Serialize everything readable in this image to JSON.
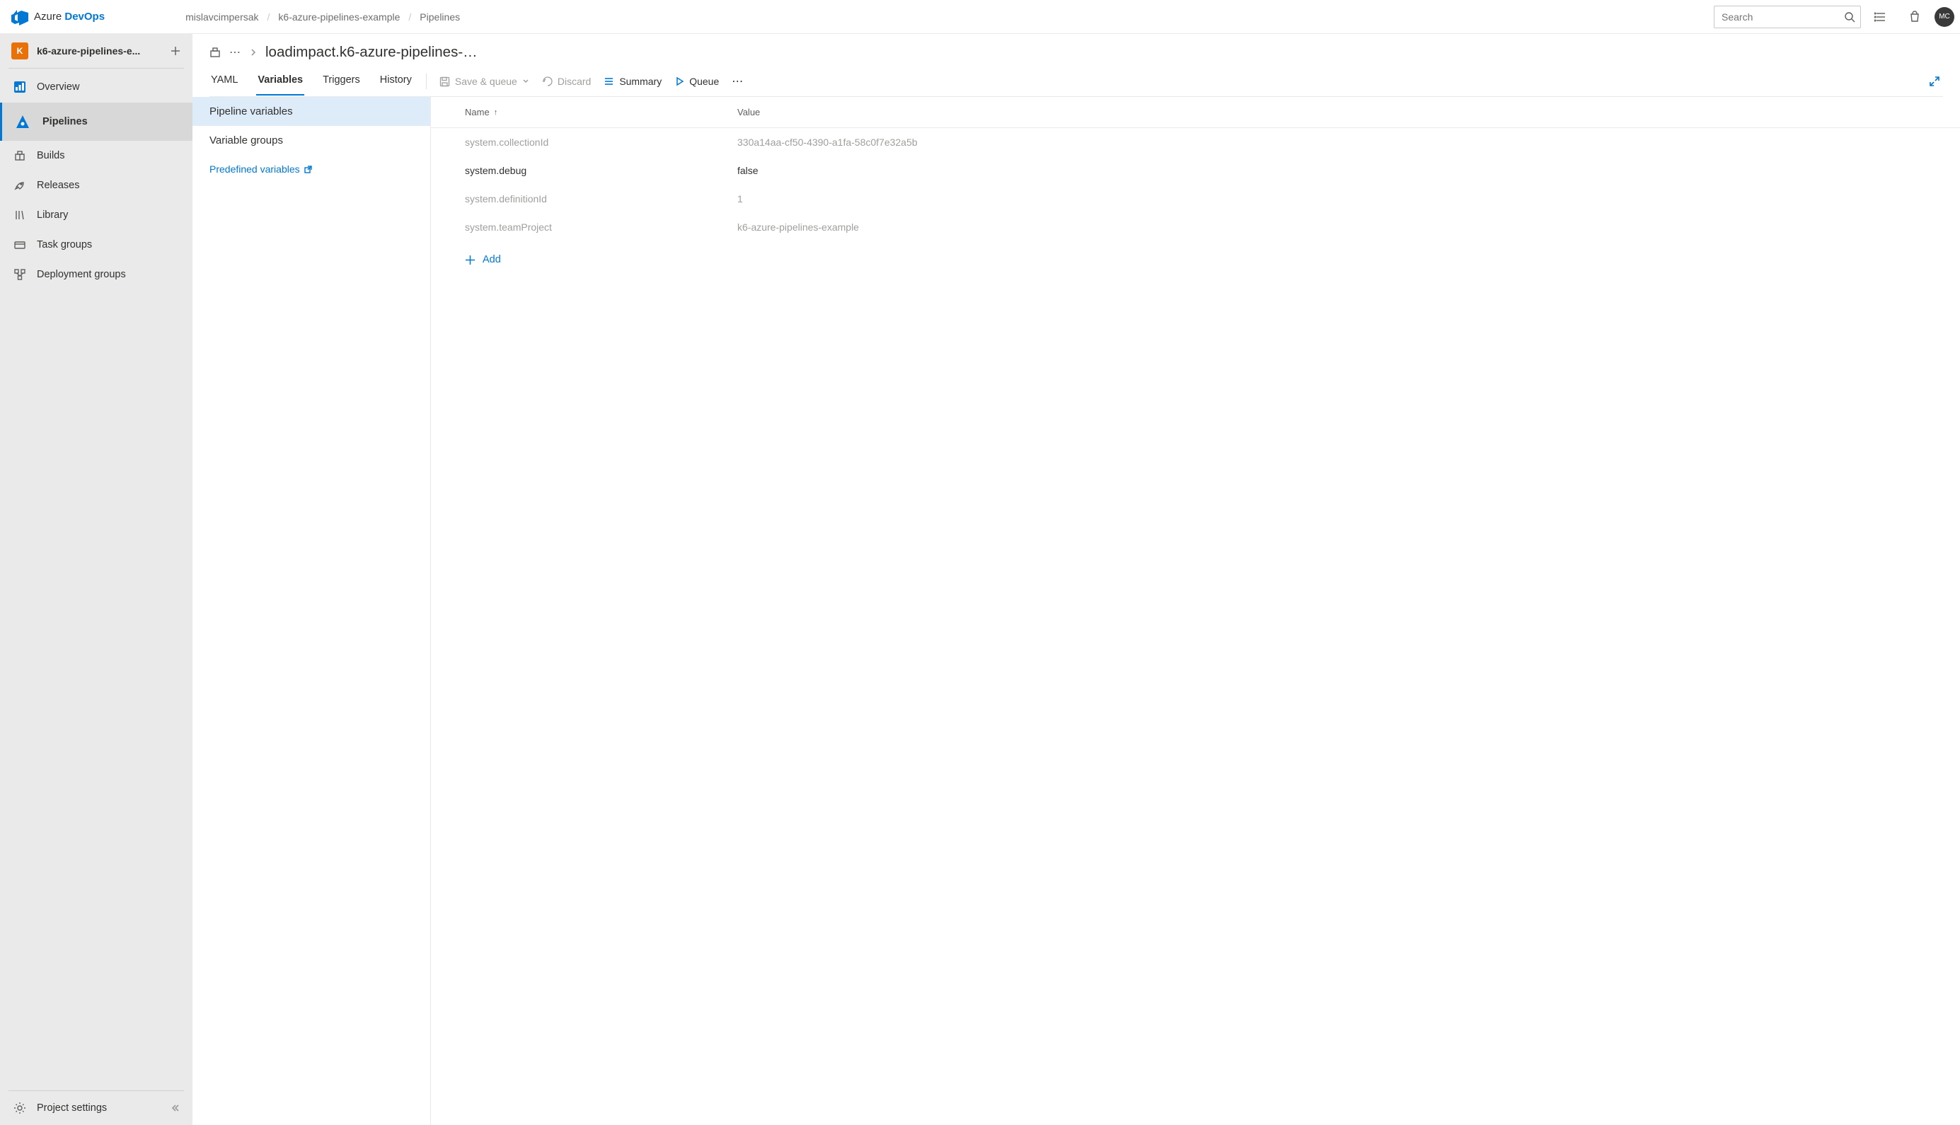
{
  "brand": {
    "azure": "Azure",
    "devops": "DevOps"
  },
  "breadcrumbs": {
    "org": "mislavcimpersak",
    "project": "k6-azure-pipelines-example",
    "section": "Pipelines"
  },
  "search": {
    "placeholder": "Search"
  },
  "avatar": {
    "initials": "MC"
  },
  "sidebar": {
    "project_badge": "K",
    "project_name": "k6-azure-pipelines-e...",
    "items": {
      "overview": "Overview",
      "pipelines": "Pipelines",
      "builds": "Builds",
      "releases": "Releases",
      "library": "Library",
      "task_groups": "Task groups",
      "deployment_groups": "Deployment groups"
    },
    "footer": {
      "project_settings": "Project settings"
    }
  },
  "content": {
    "path_title": "loadimpact.k6-azure-pipelines-…",
    "tabs": {
      "yaml": "YAML",
      "variables": "Variables",
      "triggers": "Triggers",
      "history": "History"
    },
    "toolbar": {
      "save_queue": "Save & queue",
      "discard": "Discard",
      "summary": "Summary",
      "queue": "Queue"
    },
    "sub_nav": {
      "pipeline_variables": "Pipeline variables",
      "variable_groups": "Variable groups",
      "predefined": "Predefined variables"
    },
    "table": {
      "header": {
        "name": "Name",
        "value": "Value"
      },
      "rows": [
        {
          "name": "system.collectionId",
          "value": "330a14aa-cf50-4390-a1fa-58c0f7e32a5b",
          "readonly": true
        },
        {
          "name": "system.debug",
          "value": "false",
          "readonly": false
        },
        {
          "name": "system.definitionId",
          "value": "1",
          "readonly": true
        },
        {
          "name": "system.teamProject",
          "value": "k6-azure-pipelines-example",
          "readonly": true
        }
      ],
      "add": "Add"
    }
  }
}
